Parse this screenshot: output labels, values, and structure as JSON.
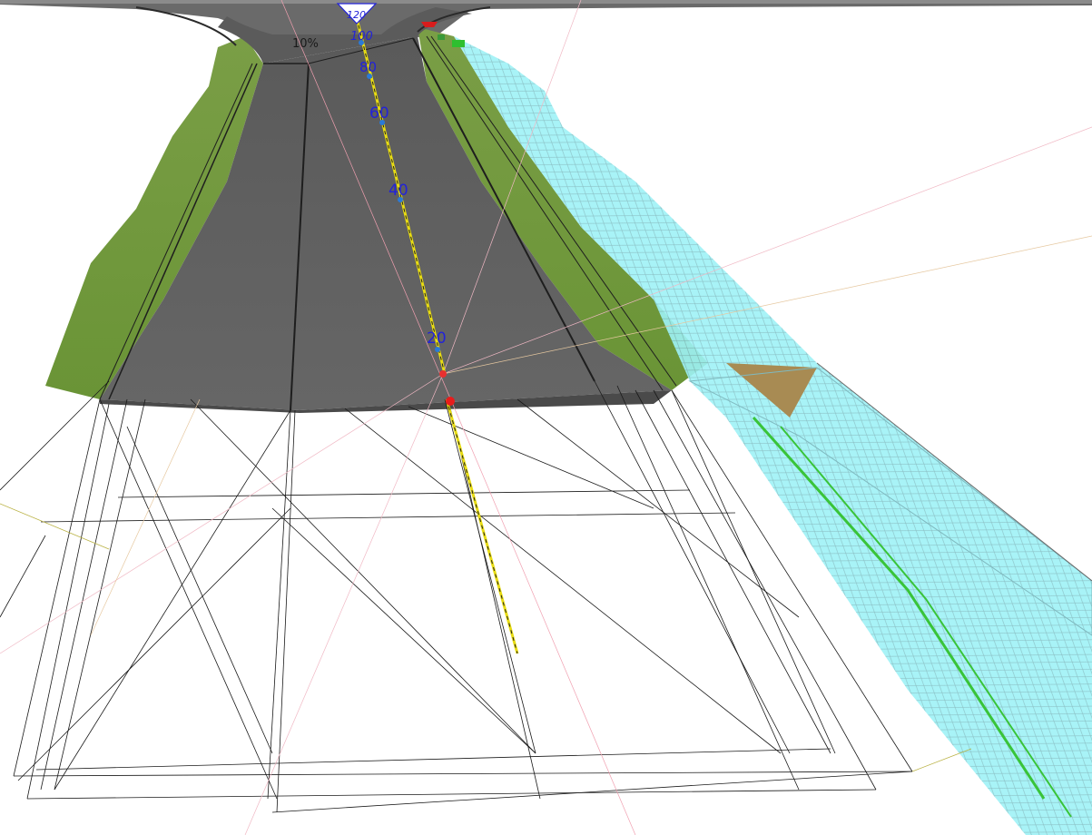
{
  "viewport": {
    "background": "#ffffff",
    "asphalt_color": "#5d5d5d",
    "grass_color": "#6f9a3c",
    "ground_mesh_color": "#9ef2f6",
    "alignment_color": "#e8dc12",
    "station_label_color": "#2323d8"
  },
  "stations": [
    {
      "label": "120"
    },
    {
      "label": "100"
    },
    {
      "label": "80"
    },
    {
      "label": "60"
    },
    {
      "label": "40"
    },
    {
      "label": "20"
    }
  ],
  "grade_label": "10%",
  "markers": {
    "start_point": "red-point",
    "end_point": "red-marker",
    "green_marker": "green-marker"
  }
}
